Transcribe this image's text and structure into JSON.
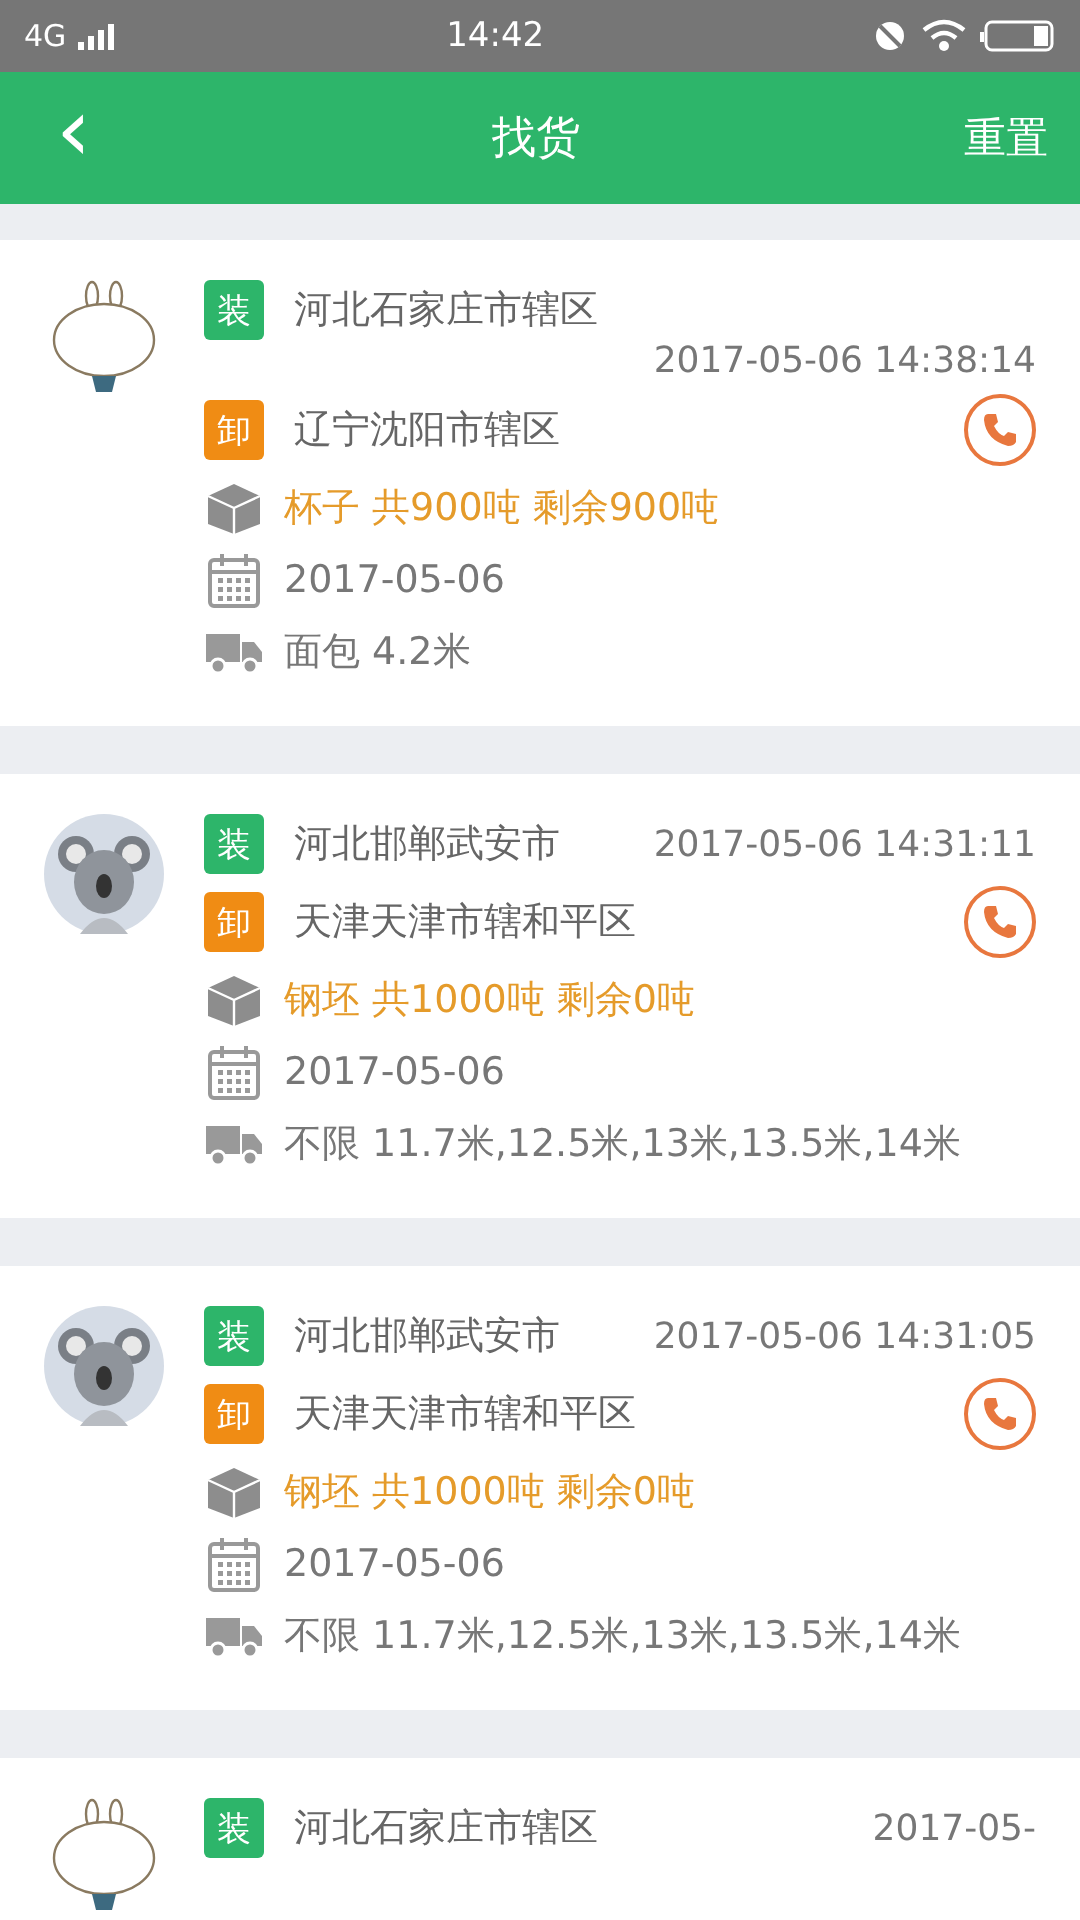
{
  "status_bar": {
    "network": "4G",
    "time": "14:42"
  },
  "header": {
    "back": "‹",
    "title": "找货",
    "action": "重置"
  },
  "orders": [
    {
      "avatar": {
        "kind": "bunny"
      },
      "load_tag": "装",
      "load": "河北石家庄市辖区",
      "time": "2017-05-06 14:38:14",
      "unload_tag": "卸",
      "unload": "辽宁沈阳市辖区",
      "cargo": "杯子 共900吨 剩余900吨",
      "date": "2017-05-06",
      "vehicle": "面包 4.2米"
    },
    {
      "avatar": {
        "kind": "koala"
      },
      "load_tag": "装",
      "load": "河北邯郸武安市",
      "time": "2017-05-06 14:31:11",
      "unload_tag": "卸",
      "unload": "天津天津市辖和平区",
      "cargo": "钢坯 共1000吨 剩余0吨",
      "date": "2017-05-06",
      "vehicle": "不限 11.7米,12.5米,13米,13.5米,14米"
    },
    {
      "avatar": {
        "kind": "koala"
      },
      "load_tag": "装",
      "load": "河北邯郸武安市",
      "time": "2017-05-06 14:31:05",
      "unload_tag": "卸",
      "unload": "天津天津市辖和平区",
      "cargo": "钢坯 共1000吨 剩余0吨",
      "date": "2017-05-06",
      "vehicle": "不限 11.7米,12.5米,13米,13.5米,14米"
    },
    {
      "avatar": {
        "kind": "bunny"
      },
      "load_tag": "装",
      "load": "河北石家庄市辖区",
      "time": "2017-05-"
    }
  ]
}
